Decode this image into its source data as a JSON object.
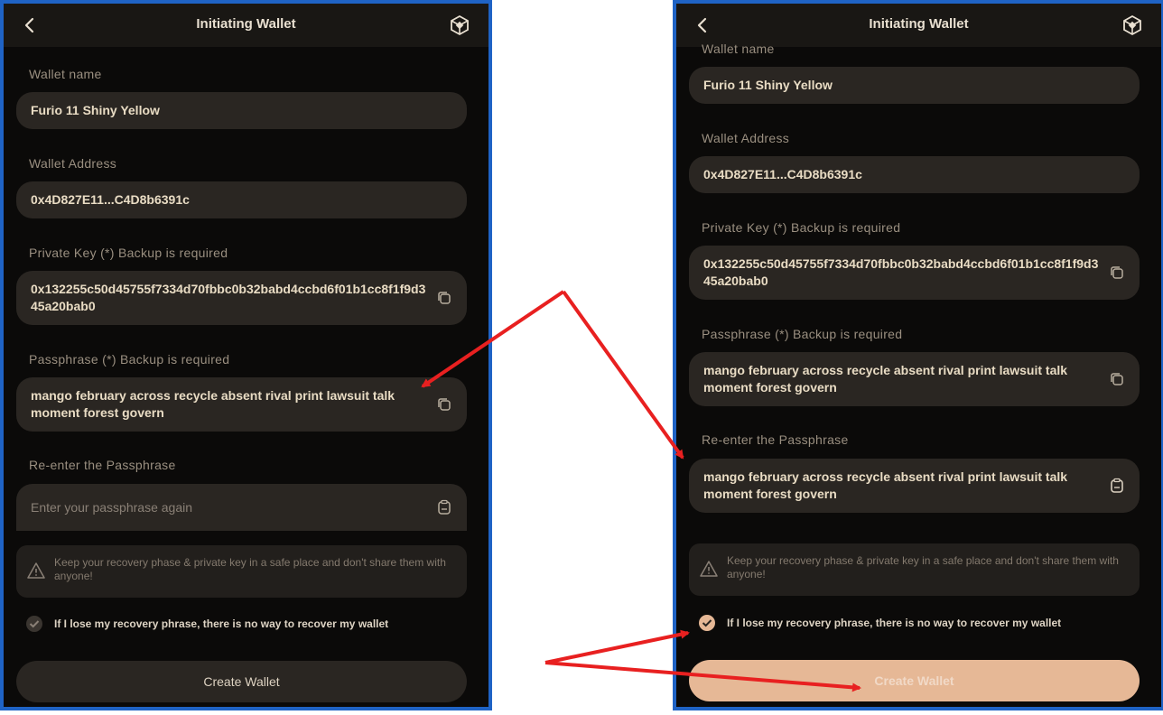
{
  "colors": {
    "frame_border": "#1f63c5",
    "background": "#0b0a09",
    "field": "#2a2622",
    "accent_button": "#e6b896",
    "arrow": "#e82020"
  },
  "left_screen": {
    "title": "Initiating Wallet",
    "wallet_name_label": "Wallet name",
    "wallet_name_value": "Furio 11 Shiny Yellow",
    "wallet_address_label": "Wallet Address",
    "wallet_address_value": "0x4D827E11...C4D8b6391c",
    "private_key_label": "Private Key (*) Backup is required",
    "private_key_value": "0x132255c50d45755f7334d70fbbc0b32babd4ccbd6f01b1cc8f1f9d345a20bab0",
    "passphrase_label": "Passphrase (*) Backup is required",
    "passphrase_value": "mango february across recycle absent rival print lawsuit talk moment forest govern",
    "reenter_label": "Re-enter the Passphrase",
    "reenter_placeholder": "Enter your passphrase again",
    "warning_text": "Keep your recovery phase & private key in a safe place and don't share them with anyone!",
    "checkbox_label": "If I lose my recovery phrase, there is no way to recover my wallet",
    "checkbox_checked": true,
    "create_button": "Create Wallet"
  },
  "right_screen": {
    "title": "Initiating Wallet",
    "wallet_name_label": "Wallet name",
    "wallet_name_value": "Furio 11 Shiny Yellow",
    "wallet_address_label": "Wallet Address",
    "wallet_address_value": "0x4D827E11...C4D8b6391c",
    "private_key_label": "Private Key (*) Backup is required",
    "private_key_value": "0x132255c50d45755f7334d70fbbc0b32babd4ccbd6f01b1cc8f1f9d345a20bab0",
    "passphrase_label": "Passphrase (*) Backup is required",
    "passphrase_value": "mango february across recycle absent rival print lawsuit talk moment forest govern",
    "reenter_label": "Re-enter the Passphrase",
    "reenter_value": "mango february across recycle absent rival print lawsuit talk moment forest govern",
    "warning_text": "Keep your recovery phase & private key in a safe place and don't share them with anyone!",
    "checkbox_label": "If I lose my recovery phrase, there is no way to recover my wallet",
    "checkbox_checked": true,
    "create_button": "Create Wallet"
  }
}
